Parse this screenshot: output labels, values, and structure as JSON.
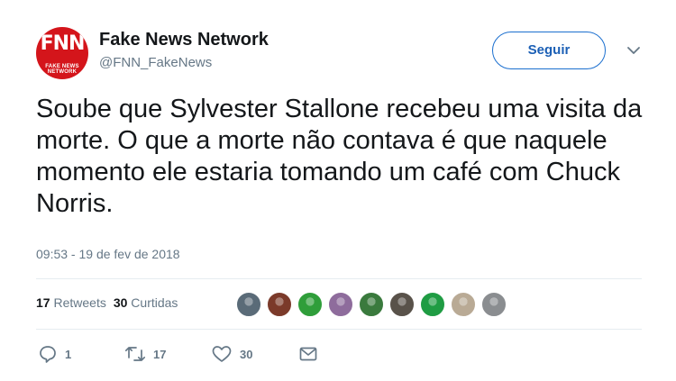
{
  "account": {
    "display_name": "Fake News Network",
    "handle": "@FNN_FakeNews",
    "avatar_logo": "FNN",
    "avatar_subtext": "FAKE NEWS NETWORK"
  },
  "follow_button": {
    "label": "Seguir"
  },
  "tweet": {
    "text": "Soube que Sylvester Stallone recebeu uma visita da morte. O que a morte não contava é que naquele momento ele estaria tomando um café com Chuck Norris.",
    "timestamp": "09:53 - 19 de fev de 2018"
  },
  "stats": {
    "retweets_count": "17",
    "retweets_label": "Retweets",
    "likes_count": "30",
    "likes_label": "Curtidas"
  },
  "liked_by_avatars": [
    {
      "color": "#5a6b78"
    },
    {
      "color": "#7b3a2a"
    },
    {
      "color": "#2f9e3a"
    },
    {
      "color": "#8e6c9c"
    },
    {
      "color": "#3a7a3d"
    },
    {
      "color": "#59524a"
    },
    {
      "color": "#1f9c43"
    },
    {
      "color": "#b9aa95"
    },
    {
      "color": "#8a8d90"
    }
  ],
  "actions": {
    "reply_count": "1",
    "retweet_count": "17",
    "like_count": "30",
    "icons": [
      "reply-icon",
      "retweet-icon",
      "heart-icon",
      "message-icon"
    ]
  },
  "colors": {
    "accent": "#1b6fcf",
    "brand_red": "#d4151b",
    "muted": "#657786",
    "divider": "#e6ecf0"
  }
}
